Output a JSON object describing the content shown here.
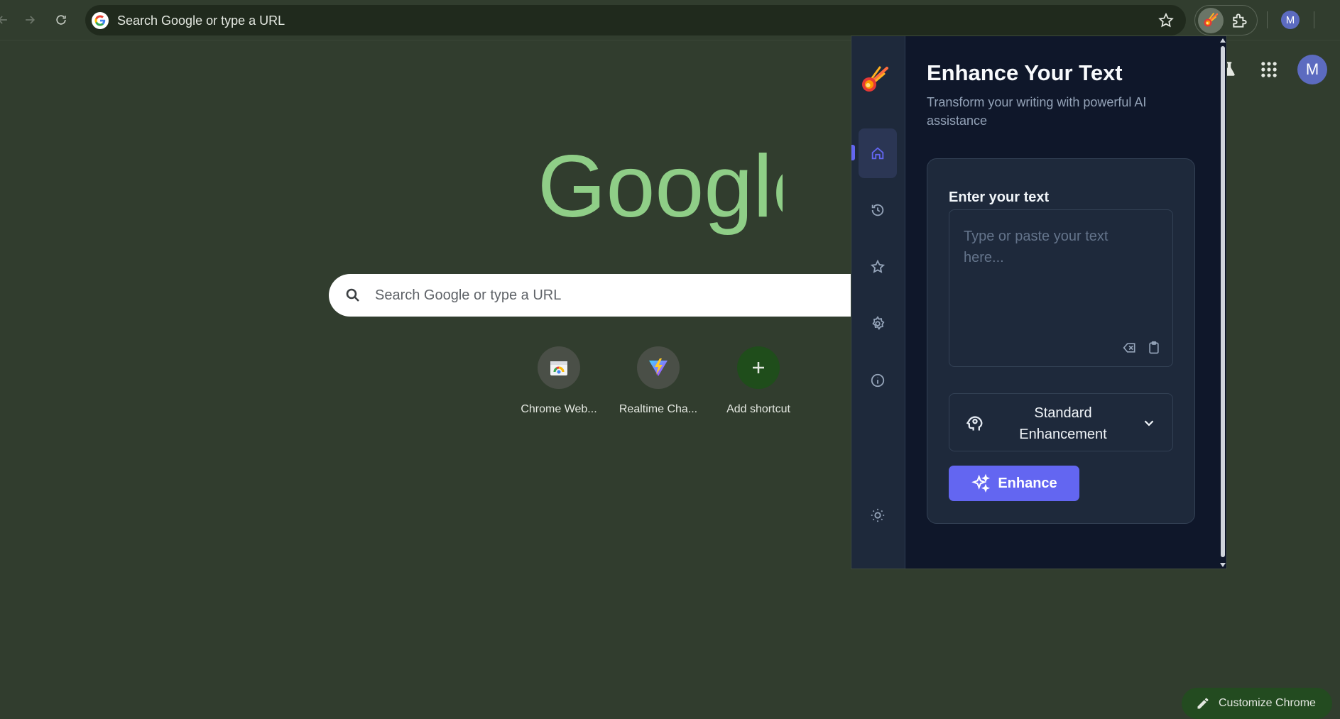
{
  "omnibox": {
    "placeholder": "Search Google or type a URL"
  },
  "toolbar": {
    "profile_initial": "M"
  },
  "ntp": {
    "logo_text": "Google",
    "search_placeholder": "Search Google or type a URL",
    "avatar_initial": "M",
    "shortcuts": [
      {
        "label": "Chrome Web...",
        "icon": "chrome-web-store-icon"
      },
      {
        "label": "Realtime Cha...",
        "icon": "vite-icon"
      },
      {
        "label": "Add shortcut",
        "icon": "plus-icon"
      }
    ],
    "customize_label": "Customize Chrome"
  },
  "popup": {
    "title": "Enhance Your Text",
    "subtitle": "Transform your writing with powerful AI assistance",
    "nav": [
      "home",
      "history",
      "favorites",
      "settings",
      "info",
      "theme"
    ],
    "active_nav": "home",
    "input_label": "Enter your text",
    "input_placeholder": "Type or paste your text here...",
    "mode_label": "Standard Enhancement",
    "enhance_label": "Enhance",
    "accent_color": "#6366f1"
  },
  "colors": {
    "page_bg": "#313d2e",
    "popup_bg": "#0f172a",
    "google_logo": "#8fce87"
  }
}
